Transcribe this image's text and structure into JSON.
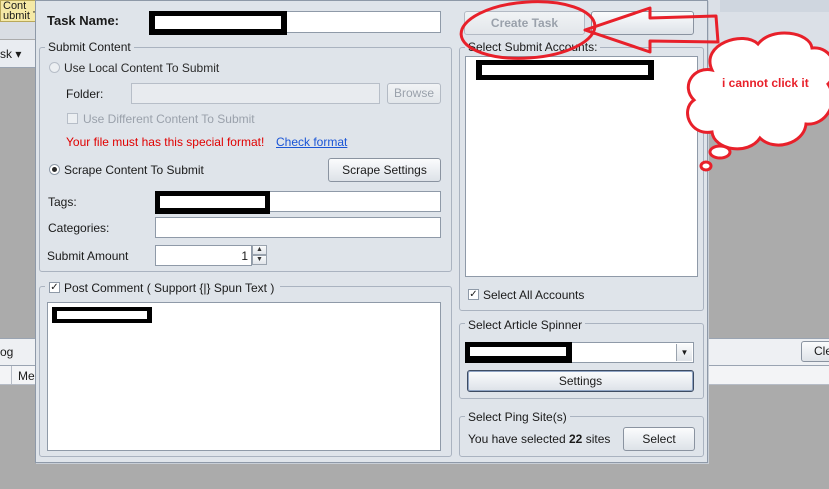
{
  "background": {
    "tab_label": "Cont\nubmit T",
    "menu_label": "sk ▾",
    "log_label": "og",
    "clear_button_label": "Cle",
    "column_label": "Me"
  },
  "dialog": {
    "task_name_label": "Task Name:",
    "create_task_button": "Create Task",
    "submit_content": {
      "title": "Submit Content",
      "use_local_label": "Use Local Content To Submit",
      "folder_label": "Folder:",
      "browse_button": "Browse",
      "use_different_label": "Use Different Content To Submit",
      "special_format_warning": "Your file must has this special format!",
      "check_format_link": "Check format",
      "scrape_label": "Scrape Content To Submit",
      "scrape_settings_button": "Scrape Settings",
      "tags_label": "Tags:",
      "categories_label": "Categories:",
      "submit_amount_label": "Submit Amount",
      "submit_amount_value": "1"
    },
    "post_comment": {
      "label": "Post Comment ( Support {|} Spun Text )",
      "checked": true
    },
    "accounts": {
      "title": "Select Submit Accounts:",
      "select_all_label": "Select All Accounts",
      "select_all_checked": true
    },
    "spinner": {
      "title": "Select Article Spinner",
      "settings_button": "Settings"
    },
    "ping": {
      "title": "Select Ping Site(s)",
      "selected_prefix": "You have selected",
      "selected_count": "22",
      "selected_suffix": "sites",
      "select_button": "Select"
    }
  },
  "annotation": {
    "callout_text": "i cannot click it",
    "color": "#e8202a"
  },
  "colors": {
    "warning_text": "#e00000",
    "link_text": "#1a55d6",
    "dialog_bg": "#dfe4ea"
  }
}
